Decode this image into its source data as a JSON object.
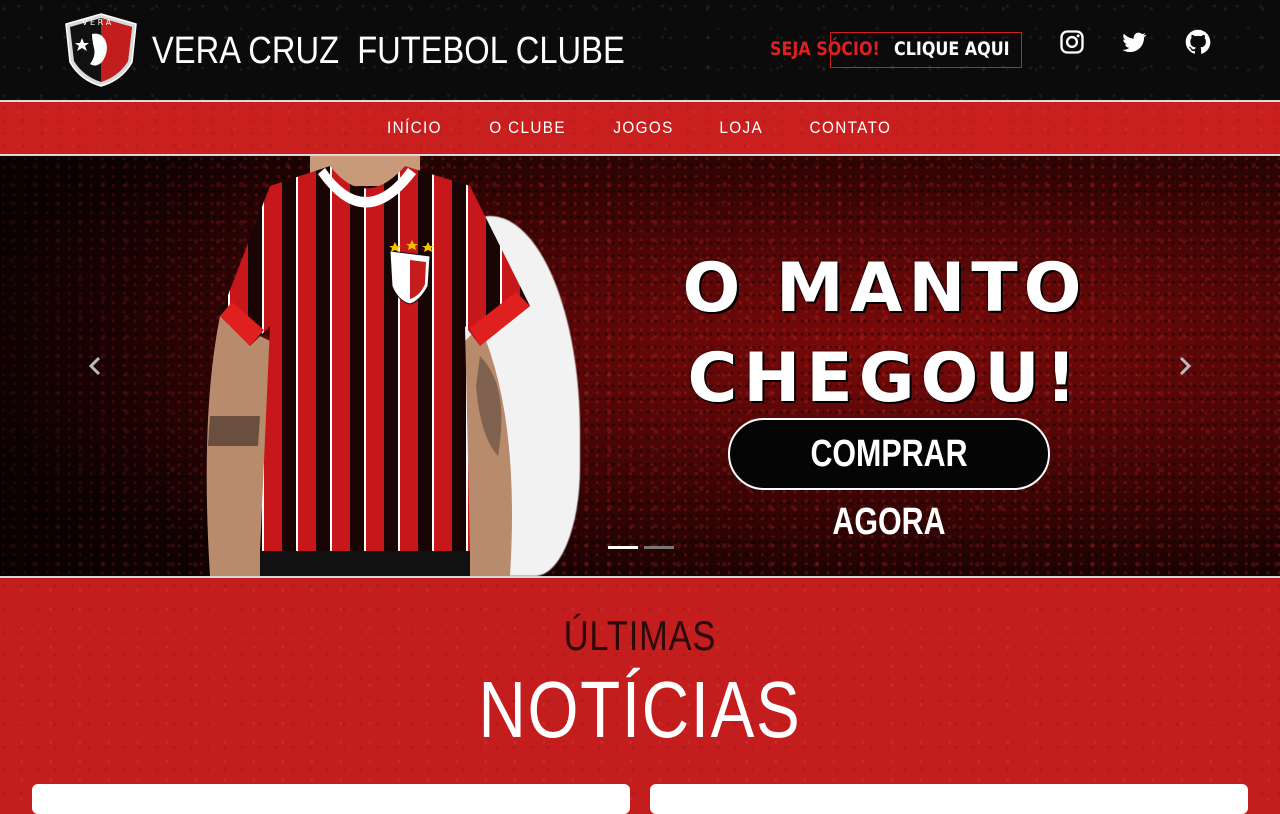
{
  "header": {
    "brand_name": "VERA CRUZ  FUTEBOL CLUBE",
    "logo_icon": "club-crest-icon",
    "cta_lead": "SEJA SÓCIO!",
    "cta_action": "CLIQUE AQUI",
    "social": [
      {
        "name": "instagram-icon"
      },
      {
        "name": "twitter-icon"
      },
      {
        "name": "github-icon"
      }
    ]
  },
  "nav": {
    "items": [
      {
        "label": "INÍCIO"
      },
      {
        "label": "O CLUBE"
      },
      {
        "label": "JOGOS"
      },
      {
        "label": "LOJA"
      },
      {
        "label": "CONTATO"
      }
    ]
  },
  "carousel": {
    "headline_line1": "O MANTO",
    "headline_line2": "CHEGOU!",
    "button_label": "COMPRAR AGORA",
    "slide_count": 2,
    "active_slide": 1
  },
  "news": {
    "subtitle": "ÚLTIMAS",
    "title": "NOTÍCIAS"
  },
  "colors": {
    "brand_red": "#c41d1d",
    "header_black": "#0b0b0b",
    "cta_red": "#e01f1f"
  }
}
